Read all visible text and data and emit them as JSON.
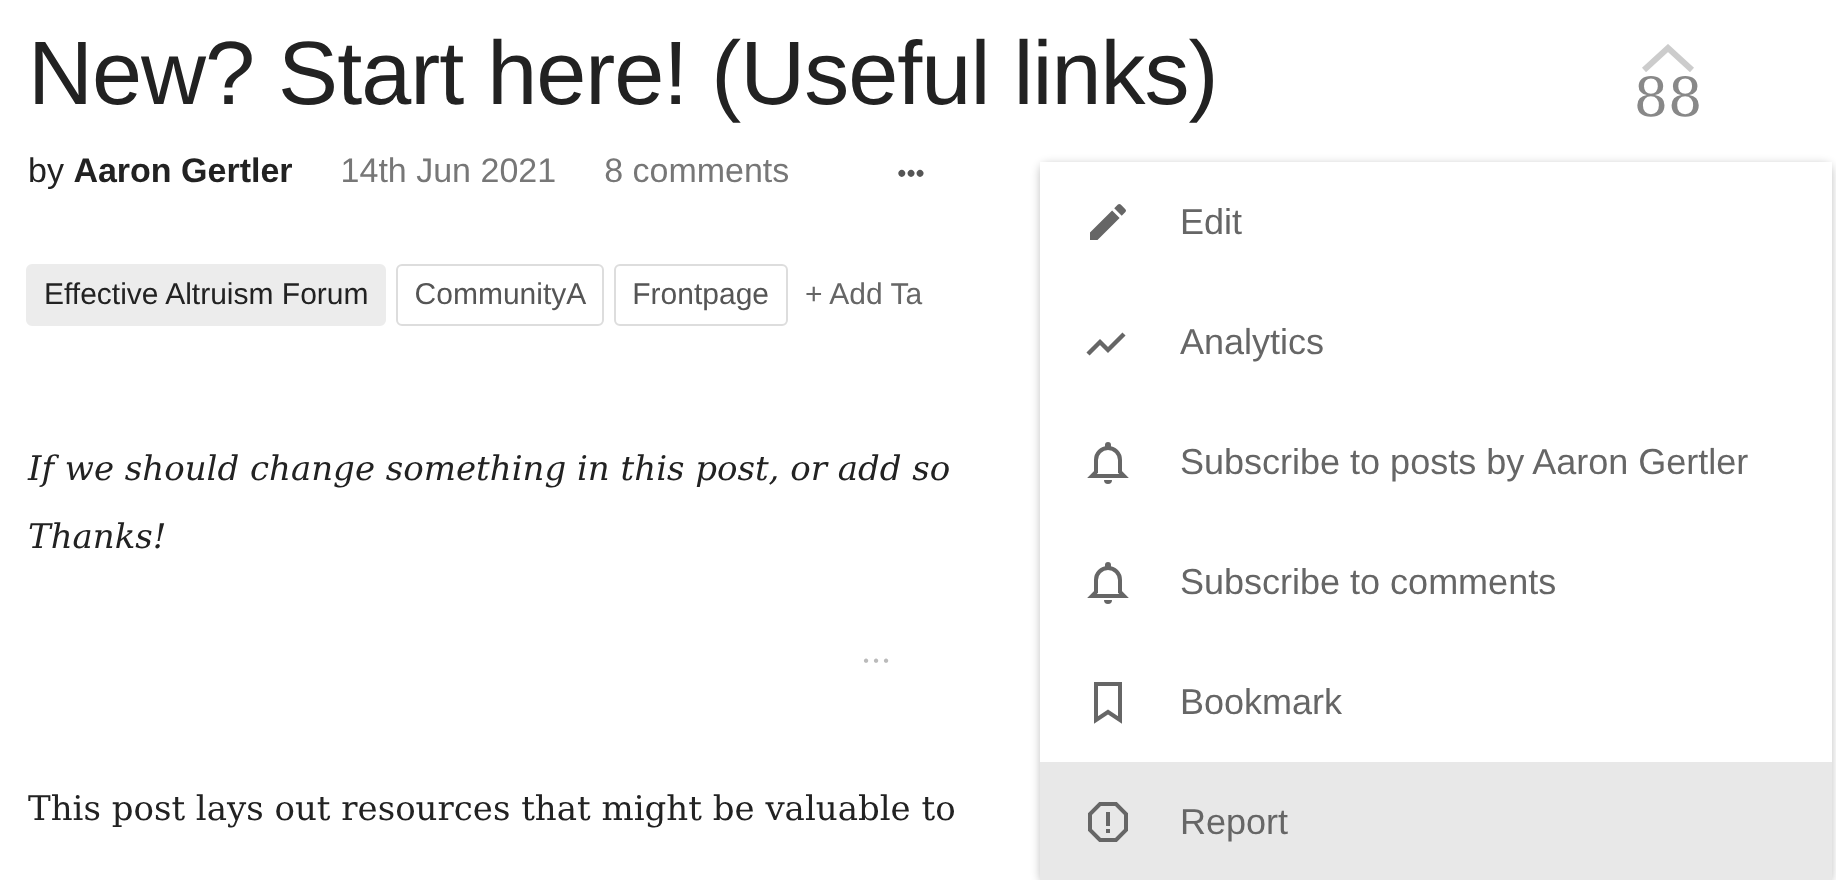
{
  "post": {
    "title": "New? Start here! (Useful links)",
    "byline_prefix": "by",
    "author": "Aaron Gertler",
    "date": "14th Jun 2021",
    "comments": "8 comments",
    "more": "•••"
  },
  "vote": {
    "score": "88"
  },
  "tags": [
    {
      "label": "Effective Altruism Forum",
      "kind": "core"
    },
    {
      "label": "CommunityA",
      "kind": "plain"
    },
    {
      "label": "Frontpage",
      "kind": "plain"
    }
  ],
  "add_tag": "+ Add Ta",
  "body": {
    "note_lines": [
      "If we should change something in this post, or add so",
      "Thanks!"
    ],
    "separator": "•   •   •",
    "paragraph": "This post lays out resources that might be valuable to"
  },
  "menu": [
    {
      "label": "Edit",
      "kind": "edit",
      "selected": false
    },
    {
      "label": "Analytics",
      "kind": "analytics",
      "selected": false
    },
    {
      "label": "Subscribe to posts by Aaron Gertler",
      "kind": "subscribe",
      "selected": false
    },
    {
      "label": "Subscribe to comments",
      "kind": "subscribe",
      "selected": false
    },
    {
      "label": "Bookmark",
      "kind": "bookmark",
      "selected": false
    },
    {
      "label": "Report",
      "kind": "report",
      "selected": true
    }
  ]
}
